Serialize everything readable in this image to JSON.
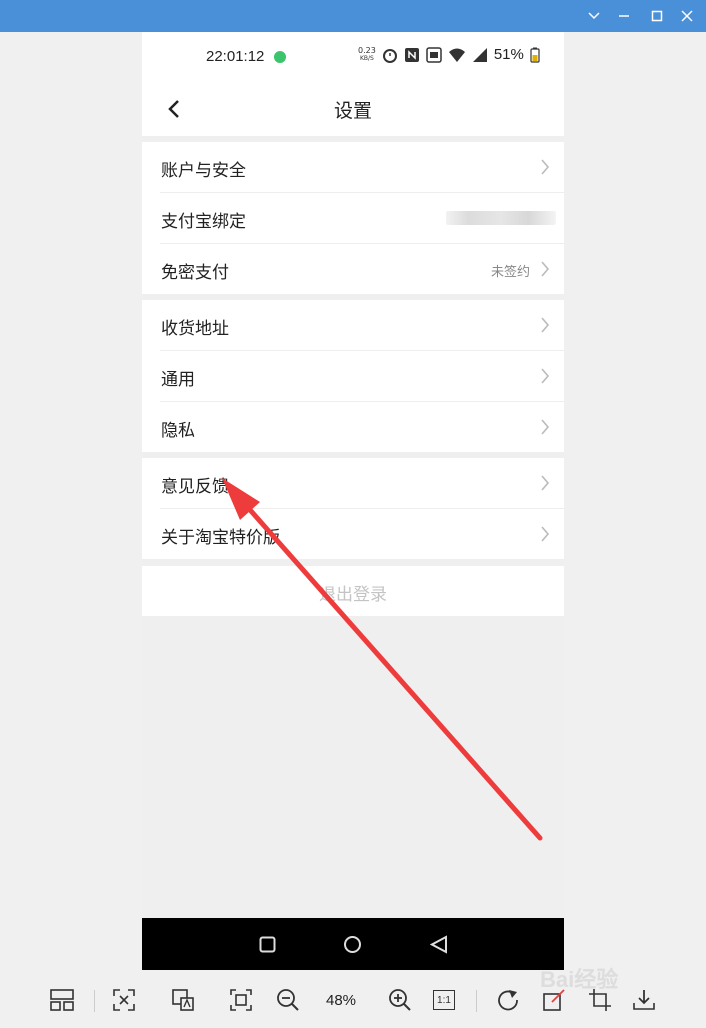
{
  "status_bar": {
    "time": "22:01:12",
    "net_speed": "0.23",
    "net_unit": "KB/S",
    "battery": "51%"
  },
  "header": {
    "title": "设置"
  },
  "groups": [
    {
      "items": [
        {
          "label": "账户与安全",
          "value": ""
        },
        {
          "label": "支付宝绑定",
          "value": ""
        },
        {
          "label": "免密支付",
          "value": "未签约"
        }
      ]
    },
    {
      "items": [
        {
          "label": "收货地址"
        },
        {
          "label": "通用"
        },
        {
          "label": "隐私"
        }
      ]
    },
    {
      "items": [
        {
          "label": "意见反馈"
        },
        {
          "label": "关于淘宝特价版"
        }
      ]
    }
  ],
  "logout": {
    "label": "退出登录"
  },
  "toolbar": {
    "zoom": "48%",
    "actual_size": "1:1"
  },
  "watermark": "Bai经验",
  "colors": {
    "titlebar": "#4a90d9",
    "annotation_arrow": "#ee3b3b"
  }
}
